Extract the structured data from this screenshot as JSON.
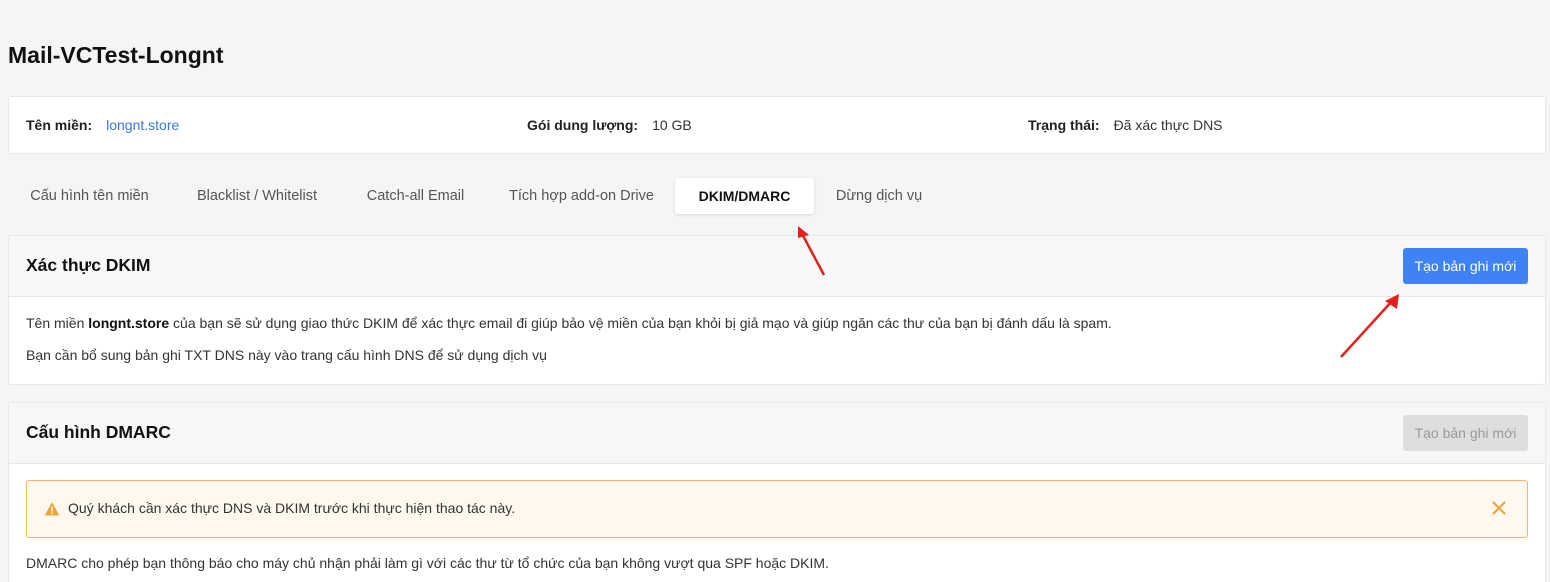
{
  "page": {
    "title": "Mail-VCTest-Longnt"
  },
  "info": {
    "domain_label": "Tên miền:",
    "domain_value": "longnt.store",
    "plan_label": "Gói dung lượng:",
    "plan_value": "10 GB",
    "status_label": "Trạng thái:",
    "status_value": "Đã xác thực DNS"
  },
  "tabs": [
    {
      "label": "Cấu hình tên miền",
      "active": false
    },
    {
      "label": "Blacklist / Whitelist",
      "active": false
    },
    {
      "label": "Catch-all Email",
      "active": false
    },
    {
      "label": "Tích hợp add-on Drive",
      "active": false
    },
    {
      "label": "DKIM/DMARC",
      "active": true
    },
    {
      "label": "Dừng dịch vụ",
      "active": false
    }
  ],
  "dkim": {
    "title": "Xác thực DKIM",
    "button": "Tạo bản ghi mới",
    "line1_prefix": "Tên miền ",
    "line1_domain": "longnt.store",
    "line1_suffix": " của bạn sẽ sử dụng giao thức DKIM để xác thực email đi giúp bảo vệ miền của bạn khỏi bị giả mạo và giúp ngăn các thư của bạn bị đánh dấu là spam.",
    "line2": "Bạn cần bổ sung bản ghi TXT DNS này vào trang cấu hình DNS để sử dụng dịch vụ"
  },
  "dmarc": {
    "title": "Cấu hình DMARC",
    "button": "Tạo bản ghi mới",
    "button_disabled": true,
    "alert": "Quý khách cần xác thực DNS và DKIM trước khi thực hiện thao tác này.",
    "description": "DMARC cho phép bạn thông báo cho máy chủ nhận phải làm gì với các thư từ tổ chức của bạn không vượt qua SPF hoặc DKIM."
  },
  "colors": {
    "primary": "#3f82f5",
    "link": "#3a78d8",
    "warning": "#f0a233",
    "annotation_arrow": "#e3201b"
  },
  "icons": [
    "warning-icon",
    "close-icon"
  ]
}
